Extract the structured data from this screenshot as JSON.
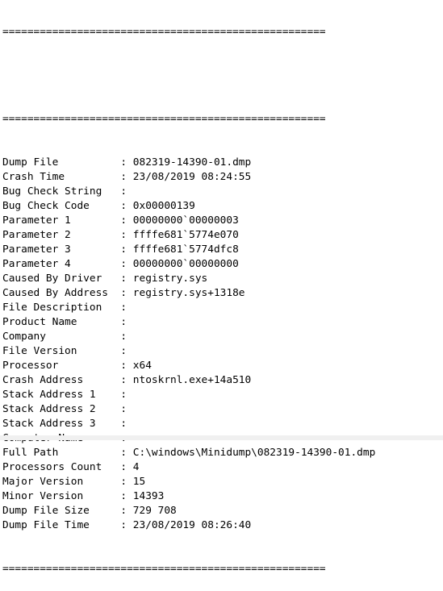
{
  "separator": "====================================================",
  "fields": [
    {
      "label": "Dump File",
      "value": "082319-14390-01.dmp"
    },
    {
      "label": "Crash Time",
      "value": "23/08/2019 08:24:55"
    },
    {
      "label": "Bug Check String",
      "value": ""
    },
    {
      "label": "Bug Check Code",
      "value": "0x00000139"
    },
    {
      "label": "Parameter 1",
      "value": "00000000`00000003"
    },
    {
      "label": "Parameter 2",
      "value": "ffffe681`5774e070"
    },
    {
      "label": "Parameter 3",
      "value": "ffffe681`5774dfc8"
    },
    {
      "label": "Parameter 4",
      "value": "00000000`00000000"
    },
    {
      "label": "Caused By Driver",
      "value": "registry.sys"
    },
    {
      "label": "Caused By Address",
      "value": "registry.sys+1318e"
    },
    {
      "label": "File Description",
      "value": ""
    },
    {
      "label": "Product Name",
      "value": ""
    },
    {
      "label": "Company",
      "value": ""
    },
    {
      "label": "File Version",
      "value": ""
    },
    {
      "label": "Processor",
      "value": "x64"
    },
    {
      "label": "Crash Address",
      "value": "ntoskrnl.exe+14a510"
    },
    {
      "label": "Stack Address 1",
      "value": ""
    },
    {
      "label": "Stack Address 2",
      "value": ""
    },
    {
      "label": "Stack Address 3",
      "value": ""
    },
    {
      "label": "Computer Name",
      "value": ""
    },
    {
      "label": "Full Path",
      "value": "C:\\windows\\Minidump\\082319-14390-01.dmp"
    },
    {
      "label": "Processors Count",
      "value": "4"
    },
    {
      "label": "Major Version",
      "value": "15"
    },
    {
      "label": "Minor Version",
      "value": "14393"
    },
    {
      "label": "Dump File Size",
      "value": "729 708"
    },
    {
      "label": "Dump File Time",
      "value": "23/08/2019 08:26:40"
    }
  ]
}
